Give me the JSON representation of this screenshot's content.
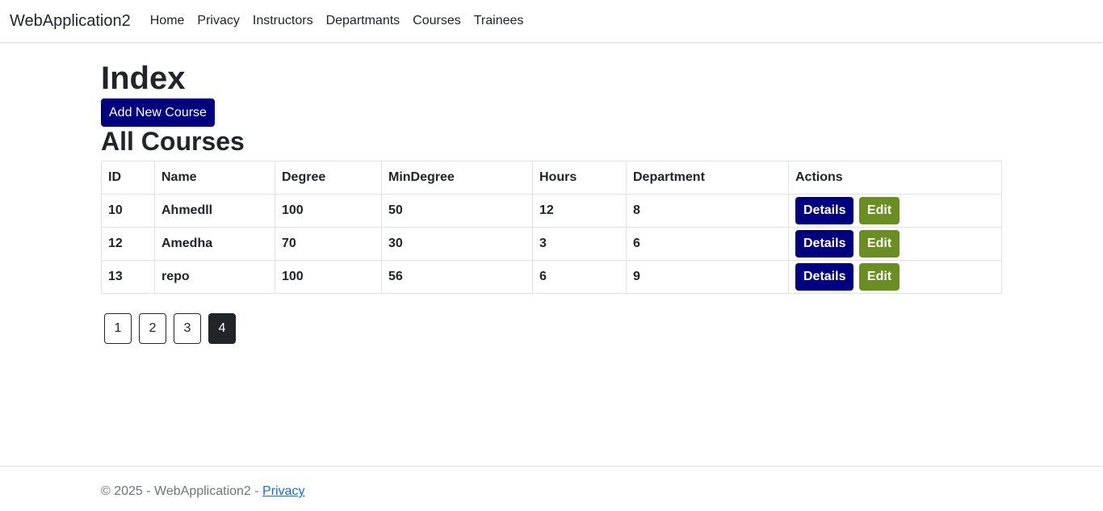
{
  "navbar": {
    "brand": "WebApplication2",
    "links": [
      "Home",
      "Privacy",
      "Instructors",
      "Departmants",
      "Courses",
      "Trainees"
    ]
  },
  "page": {
    "title": "Index",
    "add_button": "Add New Course",
    "section_title": "All Courses"
  },
  "table": {
    "headers": [
      "ID",
      "Name",
      "Degree",
      "MinDegree",
      "Hours",
      "Department",
      "Actions"
    ],
    "rows": [
      {
        "id": "10",
        "name": "Ahmedll",
        "degree": "100",
        "min_degree": "50",
        "hours": "12",
        "department": "8"
      },
      {
        "id": "12",
        "name": "Amedha",
        "degree": "70",
        "min_degree": "30",
        "hours": "3",
        "department": "6"
      },
      {
        "id": "13",
        "name": "repo",
        "degree": "100",
        "min_degree": "56",
        "hours": "6",
        "department": "9"
      }
    ],
    "details_label": "Details",
    "edit_label": "Edit"
  },
  "pagination": {
    "pages": [
      "1",
      "2",
      "3",
      "4"
    ],
    "active_page": "4"
  },
  "footer": {
    "text": "© 2025 - WebApplication2 - ",
    "link": "Privacy"
  },
  "colors": {
    "primary_navy": "#000080",
    "edit_olive": "#6b8e23",
    "dark": "#212529",
    "link_blue": "#0d6efd"
  }
}
